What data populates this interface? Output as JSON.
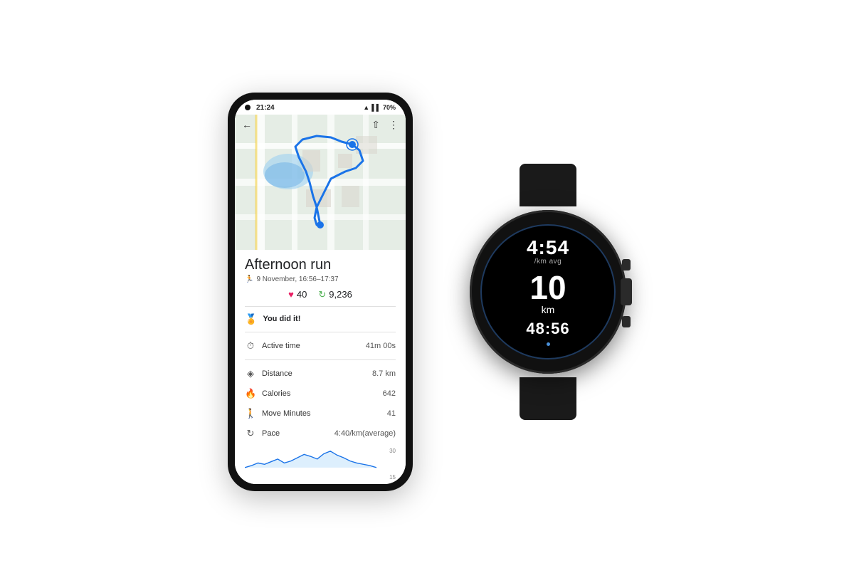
{
  "phone": {
    "status": {
      "time": "21:24",
      "battery": "70%",
      "battery_icon": "🔋"
    },
    "map": {
      "route_color": "#1a73e8"
    },
    "app_bar": {
      "back": "←",
      "share": "⇧",
      "more": "⋮"
    },
    "run": {
      "title": "Afternoon run",
      "date": "9 November, 16:56–17:37",
      "heart_points": "40",
      "steps": "9,236"
    },
    "achievement": {
      "text": "You did it!",
      "icon": "❤️"
    },
    "metrics": [
      {
        "icon": "⏱",
        "label": "Active time",
        "value": "41m 00s"
      },
      {
        "icon": "◈",
        "label": "Distance",
        "value": "8.7 km"
      },
      {
        "icon": "🔥",
        "label": "Calories",
        "value": "642"
      },
      {
        "icon": "🚶",
        "label": "Move Minutes",
        "value": "41"
      },
      {
        "icon": "↻",
        "label": "Pace",
        "value": "4:40/km(average)"
      }
    ],
    "chart": {
      "top_label": "30",
      "bottom_label": "15"
    }
  },
  "watch": {
    "pace": "4:54",
    "pace_label": "/km avg",
    "distance": "10",
    "distance_unit": "km",
    "time": "48:56"
  }
}
